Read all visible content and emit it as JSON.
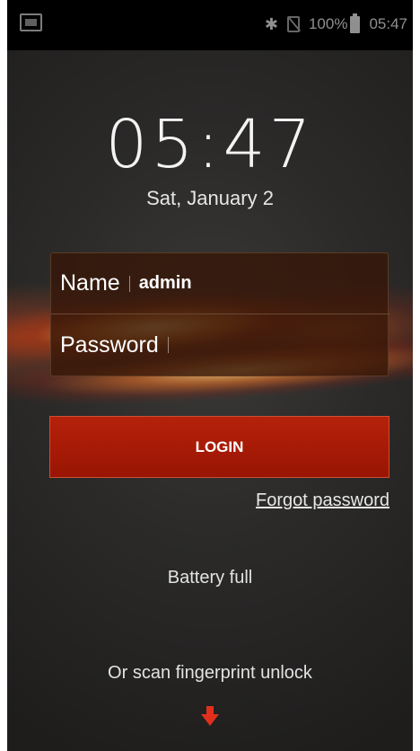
{
  "status_bar": {
    "battery_text": "100%",
    "time": "05:47",
    "icons": [
      "screenshot-icon",
      "bluetooth-icon",
      "no-sim-icon",
      "battery-icon"
    ]
  },
  "lock_screen": {
    "clock": "05:47",
    "date": "Sat, January 2"
  },
  "login_form": {
    "name_label": "Name",
    "name_value": "admin",
    "password_label": "Password",
    "password_value": "",
    "login_button": "LOGIN",
    "forgot_password": "Forgot password"
  },
  "footer": {
    "battery_status": "Battery full",
    "scan_prompt": "Or scan fingerprint unlock",
    "arrow_icon": "arrow-down-icon"
  },
  "colors": {
    "accent": "#b5210a",
    "background": "#2b2a29",
    "status_bar": "#000000"
  }
}
